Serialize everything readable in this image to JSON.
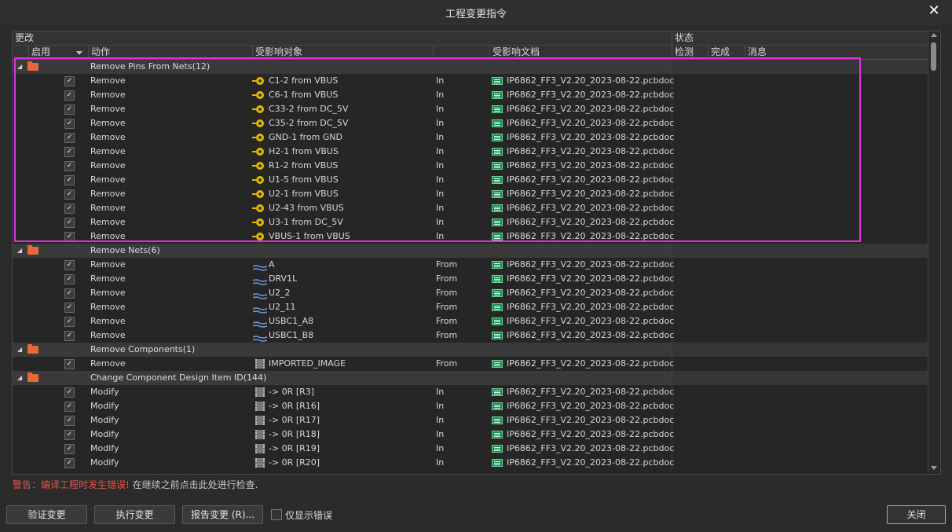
{
  "window": {
    "title": "工程变更指令",
    "close_glyph": "✕"
  },
  "table": {
    "group_headers": {
      "changes": "更改",
      "status": "状态"
    },
    "columns": {
      "enable": "启用",
      "action": "动作",
      "affected_object": "受影响对象",
      "affected_document": "受影响文档",
      "check": "检测",
      "done": "完成",
      "message": "消息"
    },
    "groups": [
      {
        "label": "Remove Pins From Nets(12)",
        "icon": "pin-icon",
        "rows": [
          {
            "action": "Remove",
            "object": "C1-2 from VBUS",
            "dir": "In",
            "doc": "IP6862_FF3_V2.20_2023-08-22.pcbdoc"
          },
          {
            "action": "Remove",
            "object": "C6-1 from VBUS",
            "dir": "In",
            "doc": "IP6862_FF3_V2.20_2023-08-22.pcbdoc"
          },
          {
            "action": "Remove",
            "object": "C33-2 from DC_5V",
            "dir": "In",
            "doc": "IP6862_FF3_V2.20_2023-08-22.pcbdoc"
          },
          {
            "action": "Remove",
            "object": "C35-2 from DC_5V",
            "dir": "In",
            "doc": "IP6862_FF3_V2.20_2023-08-22.pcbdoc"
          },
          {
            "action": "Remove",
            "object": "GND-1 from GND",
            "dir": "In",
            "doc": "IP6862_FF3_V2.20_2023-08-22.pcbdoc"
          },
          {
            "action": "Remove",
            "object": "H2-1 from VBUS",
            "dir": "In",
            "doc": "IP6862_FF3_V2.20_2023-08-22.pcbdoc"
          },
          {
            "action": "Remove",
            "object": "R1-2 from VBUS",
            "dir": "In",
            "doc": "IP6862_FF3_V2.20_2023-08-22.pcbdoc"
          },
          {
            "action": "Remove",
            "object": "U1-5 from VBUS",
            "dir": "In",
            "doc": "IP6862_FF3_V2.20_2023-08-22.pcbdoc"
          },
          {
            "action": "Remove",
            "object": "U2-1 from VBUS",
            "dir": "In",
            "doc": "IP6862_FF3_V2.20_2023-08-22.pcbdoc"
          },
          {
            "action": "Remove",
            "object": "U2-43 from VBUS",
            "dir": "In",
            "doc": "IP6862_FF3_V2.20_2023-08-22.pcbdoc"
          },
          {
            "action": "Remove",
            "object": "U3-1 from DC_5V",
            "dir": "In",
            "doc": "IP6862_FF3_V2.20_2023-08-22.pcbdoc"
          },
          {
            "action": "Remove",
            "object": "VBUS-1 from VBUS",
            "dir": "In",
            "doc": "IP6862_FF3_V2.20_2023-08-22.pcbdoc"
          }
        ]
      },
      {
        "label": "Remove Nets(6)",
        "icon": "net-icon",
        "rows": [
          {
            "action": "Remove",
            "object": "A",
            "dir": "From",
            "doc": "IP6862_FF3_V2.20_2023-08-22.pcbdoc"
          },
          {
            "action": "Remove",
            "object": "DRV1L",
            "dir": "From",
            "doc": "IP6862_FF3_V2.20_2023-08-22.pcbdoc"
          },
          {
            "action": "Remove",
            "object": "U2_2",
            "dir": "From",
            "doc": "IP6862_FF3_V2.20_2023-08-22.pcbdoc"
          },
          {
            "action": "Remove",
            "object": "U2_11",
            "dir": "From",
            "doc": "IP6862_FF3_V2.20_2023-08-22.pcbdoc"
          },
          {
            "action": "Remove",
            "object": "USBC1_A8",
            "dir": "From",
            "doc": "IP6862_FF3_V2.20_2023-08-22.pcbdoc"
          },
          {
            "action": "Remove",
            "object": "USBC1_B8",
            "dir": "From",
            "doc": "IP6862_FF3_V2.20_2023-08-22.pcbdoc"
          }
        ]
      },
      {
        "label": "Remove Components(1)",
        "icon": "component-icon",
        "rows": [
          {
            "action": "Remove",
            "object": "IMPORTED_IMAGE",
            "dir": "From",
            "doc": "IP6862_FF3_V2.20_2023-08-22.pcbdoc"
          }
        ]
      },
      {
        "label": "Change Component Design Item ID(144)",
        "icon": "component-icon",
        "rows": [
          {
            "action": "Modify",
            "object": "-> 0R [R3]",
            "dir": "In",
            "doc": "IP6862_FF3_V2.20_2023-08-22.pcbdoc"
          },
          {
            "action": "Modify",
            "object": "-> 0R [R16]",
            "dir": "In",
            "doc": "IP6862_FF3_V2.20_2023-08-22.pcbdoc"
          },
          {
            "action": "Modify",
            "object": "-> 0R [R17]",
            "dir": "In",
            "doc": "IP6862_FF3_V2.20_2023-08-22.pcbdoc"
          },
          {
            "action": "Modify",
            "object": "-> 0R [R18]",
            "dir": "In",
            "doc": "IP6862_FF3_V2.20_2023-08-22.pcbdoc"
          },
          {
            "action": "Modify",
            "object": "-> 0R [R19]",
            "dir": "In",
            "doc": "IP6862_FF3_V2.20_2023-08-22.pcbdoc"
          },
          {
            "action": "Modify",
            "object": "-> 0R [R20]",
            "dir": "In",
            "doc": "IP6862_FF3_V2.20_2023-08-22.pcbdoc"
          }
        ]
      }
    ]
  },
  "warning": {
    "label": "警告：编译工程时发生错误!",
    "hint": "在继续之前点击此处进行检查."
  },
  "buttons": {
    "validate": "验证变更",
    "execute": "执行变更",
    "report": "报告变更 (R)...",
    "only_errors": "仅显示错误",
    "close": "关闭"
  },
  "colors": {
    "highlight_border": "#e030e0",
    "warning_red": "#e0554d",
    "folder": "#e8683a"
  }
}
